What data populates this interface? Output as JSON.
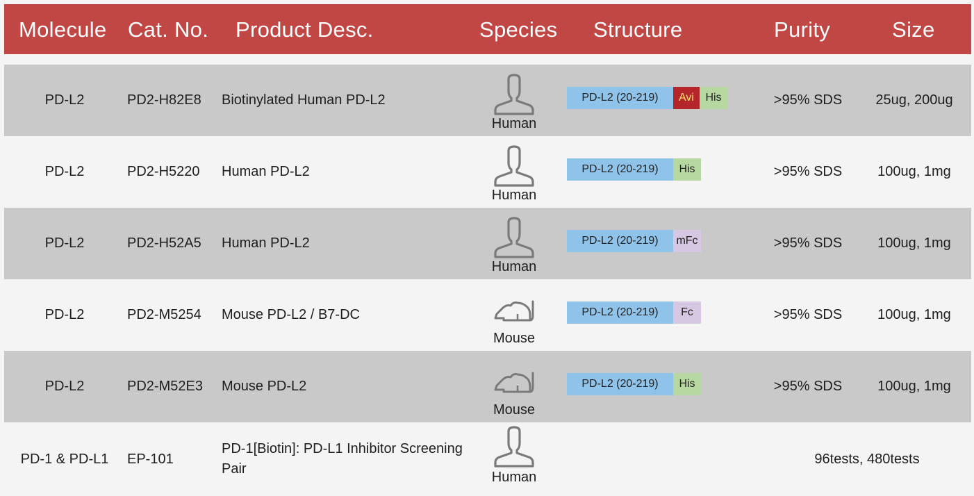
{
  "header": {
    "molecule": "Molecule",
    "cat_no": "Cat. No.",
    "product_desc": "Product Desc.",
    "species": "Species",
    "structure": "Structure",
    "purity": "Purity",
    "size": "Size"
  },
  "colors": {
    "header_bg": "#c14744",
    "row_alt": "#c9c9c9",
    "segment_main": "#8fc3ea",
    "segment_avi": "#b5262a",
    "segment_his": "#b7d8a0",
    "segment_fc": "#d6c7e2"
  },
  "rows": [
    {
      "molecule": "PD-L2",
      "cat_no": "PD2-H82E8",
      "desc": "Biotinylated Human PD-L2",
      "species_icon": "human-icon",
      "species": "Human",
      "structure": [
        "PD-L2 (20-219)",
        "Avi",
        "His"
      ],
      "purity": "&gt;95% SDS",
      "size": "25ug, 200ug"
    },
    {
      "molecule": "PD-L2",
      "cat_no": "PD2-H5220",
      "desc": "Human PD-L2",
      "species_icon": "human-icon",
      "species": "Human",
      "structure": [
        "PD-L2 (20-219)",
        "His"
      ],
      "purity": "&gt;95% SDS",
      "size": "100ug, 1mg"
    },
    {
      "molecule": "PD-L2",
      "cat_no": "PD2-H52A5",
      "desc": "Human PD-L2",
      "species_icon": "human-icon",
      "species": "Human",
      "structure": [
        "PD-L2 (20-219)",
        "mFc"
      ],
      "purity": "&gt;95% SDS",
      "size": "100ug, 1mg"
    },
    {
      "molecule": "PD-L2",
      "cat_no": "PD2-M5254",
      "desc": "Mouse PD-L2 / B7-DC",
      "species_icon": "mouse-icon",
      "species": "Mouse",
      "structure": [
        "PD-L2 (20-219)",
        "Fc"
      ],
      "purity": "&gt;95% SDS",
      "size": "100ug, 1mg"
    },
    {
      "molecule": "PD-L2",
      "cat_no": "PD2-M52E3",
      "desc": "Mouse PD-L2",
      "species_icon": "mouse-icon",
      "species": "Mouse",
      "structure": [
        "PD-L2 (20-219)",
        "His"
      ],
      "purity": "&gt;95% SDS",
      "size": "100ug, 1mg"
    },
    {
      "molecule": "PD-1 &amp; PD-L1",
      "cat_no": "EP-101",
      "desc": "PD-1[Biotin]: PD-L1 Inhibitor Screening Pair",
      "species_icon": "human-icon",
      "species": "Human",
      "size": "96tests, 480tests"
    }
  ]
}
